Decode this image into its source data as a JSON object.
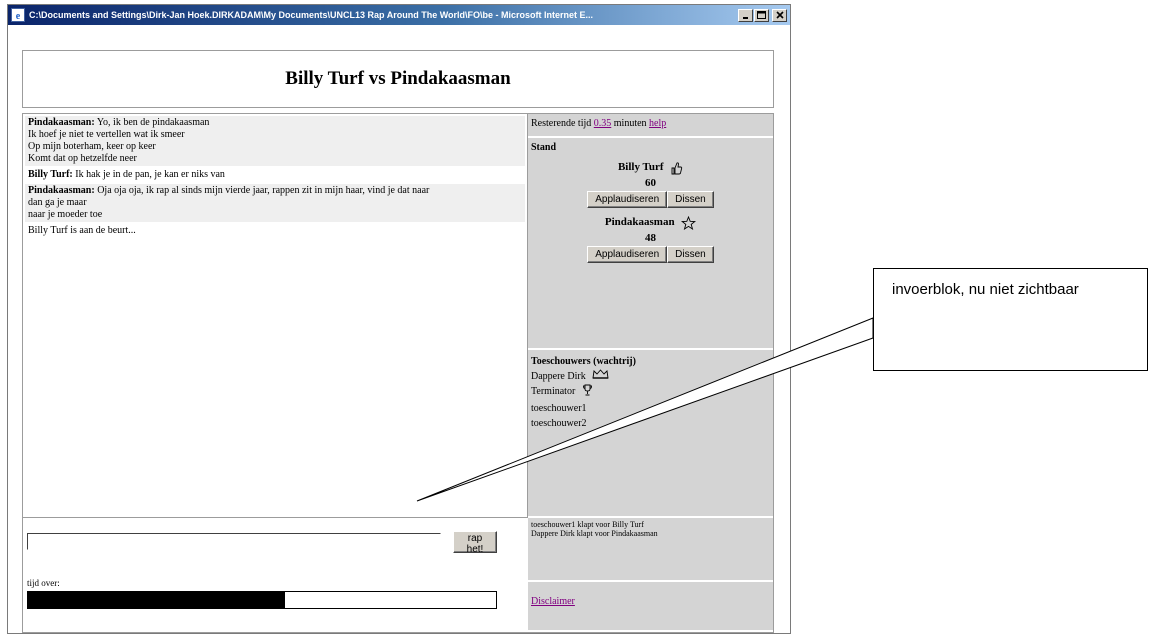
{
  "window": {
    "title": "C:\\Documents and Settings\\Dirk-Jan Hoek.DIRKADAM\\My Documents\\UNCL13 Rap Around The World\\FO\\be - Microsoft Internet E..."
  },
  "page": {
    "title": "Billy Turf vs Pindakaasman"
  },
  "messages": [
    {
      "speaker": "Pindakaasman:",
      "lines": [
        "Yo, ik ben de pindakaasman",
        "Ik hoef je niet te vertellen wat ik smeer",
        "Op mijn boterham, keer op keer",
        "Komt dat op hetzelfde neer"
      ],
      "shaded": true
    },
    {
      "speaker": "Billy Turf:",
      "lines": [
        "Ik hak je in de pan, je kan er niks van"
      ],
      "shaded": false
    },
    {
      "speaker": "Pindakaasman:",
      "lines": [
        "Oja oja oja, ik rap al sinds mijn vierde jaar, rappen zit in mijn haar, vind je dat naar",
        "dan ga je maar",
        "naar je moeder toe"
      ],
      "shaded": true
    }
  ],
  "status_line": "Billy Turf is aan de beurt...",
  "timer": {
    "prefix": "Resterende tijd",
    "value": "0.35",
    "suffix": "minuten",
    "help_link": "help"
  },
  "stand": {
    "heading": "Stand",
    "contestants": [
      {
        "name": "Billy Turf",
        "score": "60",
        "icon": "thumbs-up-icon"
      },
      {
        "name": "Pindakaasman",
        "score": "48",
        "icon": "star-icon"
      }
    ],
    "applaud_label": "Applaudiseren",
    "diss_label": "Dissen"
  },
  "audience": {
    "heading": "Toeschouwers (wachtrij)",
    "members": [
      "Dappere Dirk",
      "Terminator",
      "toeschouwer1",
      "toeschouwer2"
    ],
    "member_icons": [
      "crown-icon",
      "trophy-icon"
    ]
  },
  "applause_log": [
    "toeschouwer1 klapt voor Billy Turf",
    "Dappere Dirk klapt voor Pindakaasman"
  ],
  "disclaimer_link": "Disclaimer",
  "input": {
    "value": "",
    "button_label": "rap het!",
    "time_left_label": "tijd over:",
    "time_left_fraction": 0.55
  },
  "callout": {
    "text": "invoerblok, nu niet zichtbaar"
  },
  "colors": {
    "titlebar_start": "#0a246a",
    "titlebar_end": "#a6caf0",
    "panel_bg": "#d4d4d4",
    "link": "#800080"
  }
}
